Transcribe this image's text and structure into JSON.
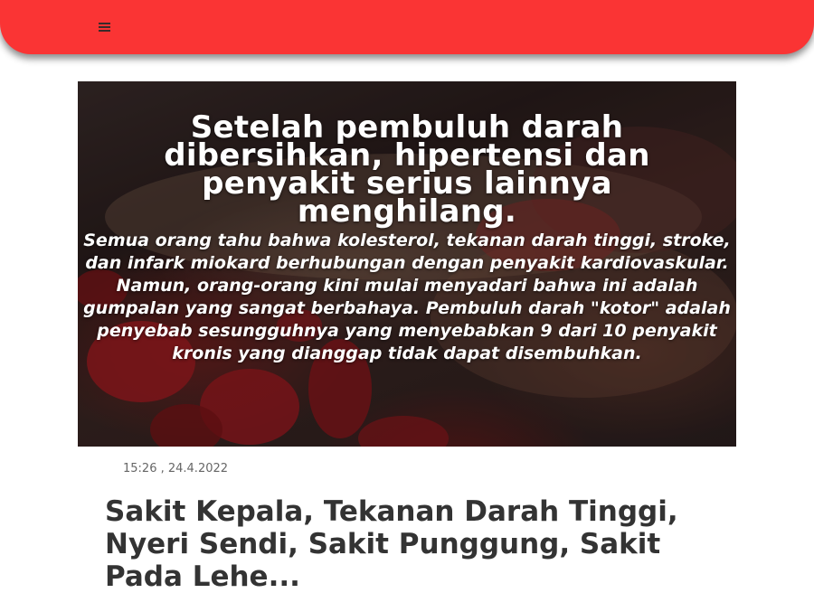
{
  "header": {
    "menu_icon": "menu-icon",
    "color": "#fa3434"
  },
  "hero": {
    "title": "Setelah pembuluh darah dibersihkan, hipertensi dan penyakit serius lainnya menghilang.",
    "text": "Semua orang tahu bahwa kolesterol, tekanan darah tinggi, stroke, dan infark miokard berhubungan dengan penyakit kardiovaskular. Namun, orang-orang kini mulai menyadari bahwa ini adalah gumpalan yang sangat berbahaya. Pembuluh darah \"kotor\" adalah penyebab sesungguhnya yang menyebabkan 9 dari 10 penyakit kronis yang dianggap tidak dapat disembuhkan."
  },
  "article": {
    "timestamp": "15:26 , 24.4.2022",
    "title": "Sakit Kepala, Tekanan Darah Tinggi, Nyeri Sendi, Sakit Punggung, Sakit Pada Lehe..."
  }
}
